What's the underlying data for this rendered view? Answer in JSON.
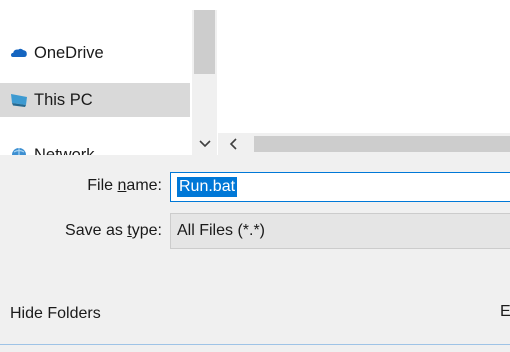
{
  "navigation": {
    "items": [
      {
        "label": "OneDrive",
        "icon": "cloud-icon",
        "selected": false
      },
      {
        "label": "This PC",
        "icon": "computer-icon",
        "selected": true
      },
      {
        "label": "Network",
        "icon": "network-icon",
        "selected": false
      }
    ]
  },
  "form": {
    "file_name_label": "File name:",
    "file_name_value": "Run.bat",
    "save_as_type_label": "Save as type:",
    "save_as_type_value": "All Files  (*.*)"
  },
  "footer": {
    "hide_folders_label": "Hide Folders",
    "edge_glyph": "E"
  },
  "colors": {
    "accent": "#0078d7",
    "selected_row": "#d9d9d9",
    "dialog_bg": "#f0f0f0",
    "scroll_thumb": "#cdcdcd"
  }
}
